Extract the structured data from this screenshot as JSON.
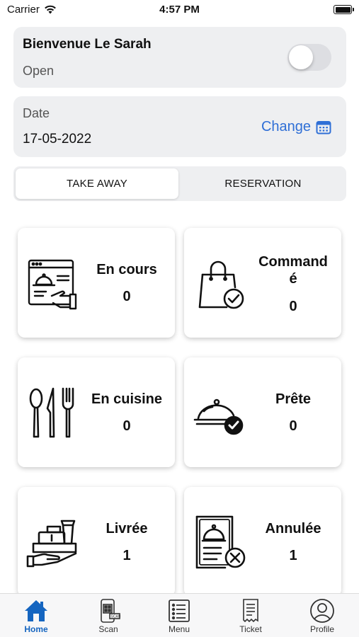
{
  "status_bar": {
    "carrier": "Carrier",
    "time": "4:57 PM"
  },
  "welcome": {
    "title": "Bienvenue Le Sarah",
    "status": "Open",
    "toggle_on": false
  },
  "date_card": {
    "label": "Date",
    "value": "17-05-2022",
    "change_label": "Change"
  },
  "segment": {
    "tabs": [
      "TAKE AWAY",
      "RESERVATION"
    ],
    "selected": "TAKE AWAY"
  },
  "tiles": [
    {
      "label": "En cours",
      "count": "0",
      "icon": "online-order-icon"
    },
    {
      "label_line1": "Command",
      "label_line2": "é",
      "count": "0",
      "icon": "shopping-bag-check-icon"
    },
    {
      "label": "En cuisine",
      "count": "0",
      "icon": "cutlery-icon"
    },
    {
      "label": "Prête",
      "count": "0",
      "icon": "cloche-check-icon"
    },
    {
      "label": "Livrée",
      "count": "1",
      "icon": "delivery-hand-icon"
    },
    {
      "label": "Annulée",
      "count": "1",
      "icon": "cancelled-menu-icon"
    }
  ],
  "tabbar": {
    "items": [
      {
        "label": "Home",
        "icon": "home-icon",
        "active": true
      },
      {
        "label": "Scan",
        "icon": "scan-icon",
        "active": false
      },
      {
        "label": "Menu",
        "icon": "menu-list-icon",
        "active": false
      },
      {
        "label": "Ticket",
        "icon": "ticket-icon",
        "active": false
      },
      {
        "label": "Profile",
        "icon": "profile-icon",
        "active": false
      }
    ]
  },
  "colors": {
    "accent": "#2f6fd6",
    "tab_active": "#1565c0",
    "card_bg": "#eeeff1"
  }
}
